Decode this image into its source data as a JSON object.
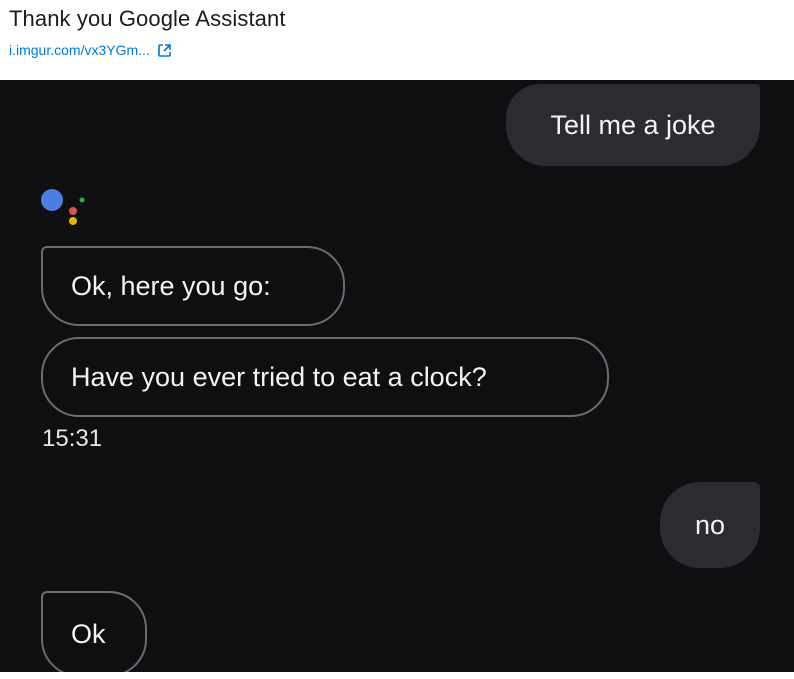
{
  "post": {
    "title": "Thank you Google Assistant",
    "link_text": "i.imgur.com/vx3YGm..."
  },
  "chat": {
    "messages": [
      {
        "sender": "user",
        "text": "Tell me a joke"
      },
      {
        "sender": "assistant",
        "text": "Ok, here you go:"
      },
      {
        "sender": "assistant",
        "text": "Have you ever tried to eat a clock?"
      },
      {
        "sender": "user",
        "text": "no"
      },
      {
        "sender": "assistant",
        "text": "Ok"
      }
    ],
    "timestamp": "15:31"
  },
  "colors": {
    "link": "#0079d3",
    "chat_background": "#0f0f12",
    "user_bubble": "#2b2b31",
    "assistant_outline": "#6b6b70",
    "assistant_dot_blue": "#4a7fe0",
    "assistant_dot_red": "#d9534f",
    "assistant_dot_yellow": "#e6b400",
    "assistant_dot_green": "#34a853"
  },
  "icons": {
    "external_link": "external-link-icon",
    "assistant": "google-assistant-icon"
  }
}
